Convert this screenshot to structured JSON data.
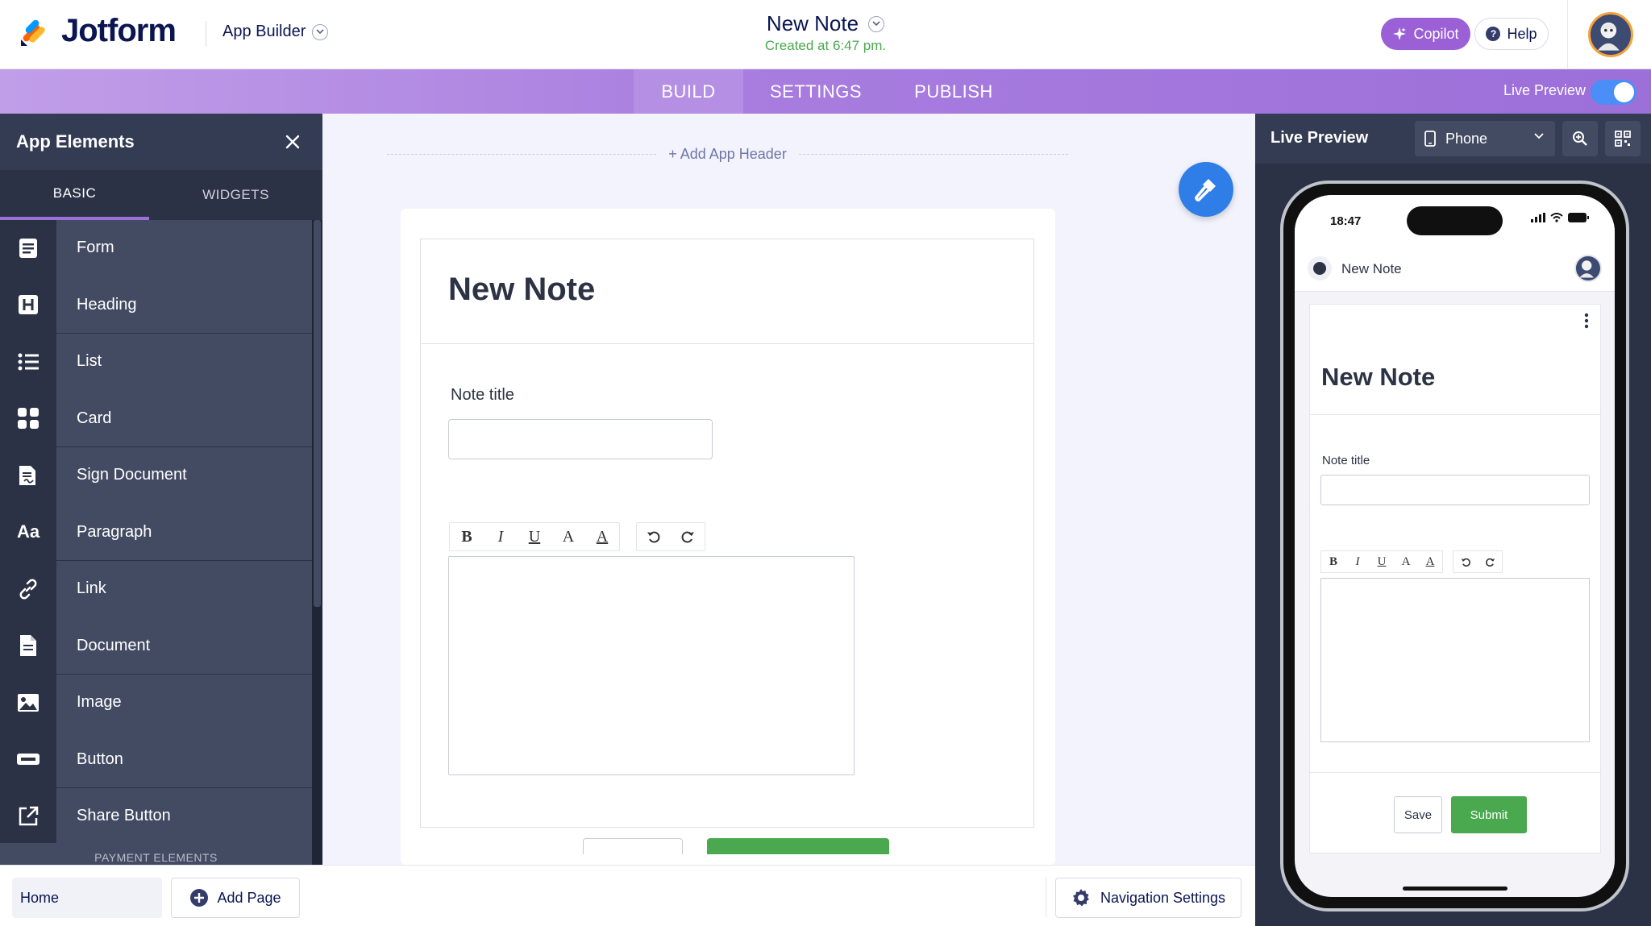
{
  "header": {
    "brand": "Jotform",
    "app_builder_label": "App Builder",
    "doc_title": "New Note",
    "doc_subtitle": "Created at 6:47 pm.",
    "copilot_label": "Copilot",
    "help_label": "Help"
  },
  "nav": {
    "tabs": [
      {
        "label": "BUILD",
        "active": true
      },
      {
        "label": "SETTINGS",
        "active": false
      },
      {
        "label": "PUBLISH",
        "active": false
      }
    ],
    "live_preview_label": "Live Preview",
    "live_preview_on": true
  },
  "elements_panel": {
    "title": "App Elements",
    "tabs": [
      "BASIC",
      "WIDGETS"
    ],
    "items": [
      {
        "label": "Form",
        "icon": "form-icon"
      },
      {
        "label": "Heading",
        "icon": "heading-icon"
      },
      {
        "label": "List",
        "icon": "list-icon"
      },
      {
        "label": "Card",
        "icon": "card-icon"
      },
      {
        "label": "Sign Document",
        "icon": "sign-document-icon"
      },
      {
        "label": "Paragraph",
        "icon": "paragraph-icon"
      },
      {
        "label": "Link",
        "icon": "link-icon"
      },
      {
        "label": "Document",
        "icon": "document-icon"
      },
      {
        "label": "Image",
        "icon": "image-icon"
      },
      {
        "label": "Button",
        "icon": "button-icon"
      },
      {
        "label": "Share Button",
        "icon": "share-icon"
      }
    ],
    "section_label": "PAYMENT ELEMENTS"
  },
  "canvas": {
    "add_header_label": "+  Add App Header",
    "form_heading": "New Note",
    "field_label": "Note title",
    "field_value": "",
    "toolbar": [
      "B",
      "I",
      "U",
      "A",
      "A"
    ],
    "toolbar_history": [
      "undo",
      "redo"
    ]
  },
  "bottom": {
    "home_page": "Home",
    "add_page_label": "Add Page",
    "nav_settings_label": "Navigation Settings"
  },
  "preview": {
    "title": "Live Preview",
    "device": "Phone",
    "phone": {
      "time": "18:47",
      "app_name": "New Note",
      "form_heading": "New Note",
      "field_label": "Note title",
      "save_label": "Save",
      "submit_label": "Submit"
    }
  },
  "colors": {
    "accent_purple": "#9b5fd6",
    "submit_green": "#4aa84f",
    "fab_blue": "#2f7ee8",
    "panel_dark": "#2b3245"
  }
}
